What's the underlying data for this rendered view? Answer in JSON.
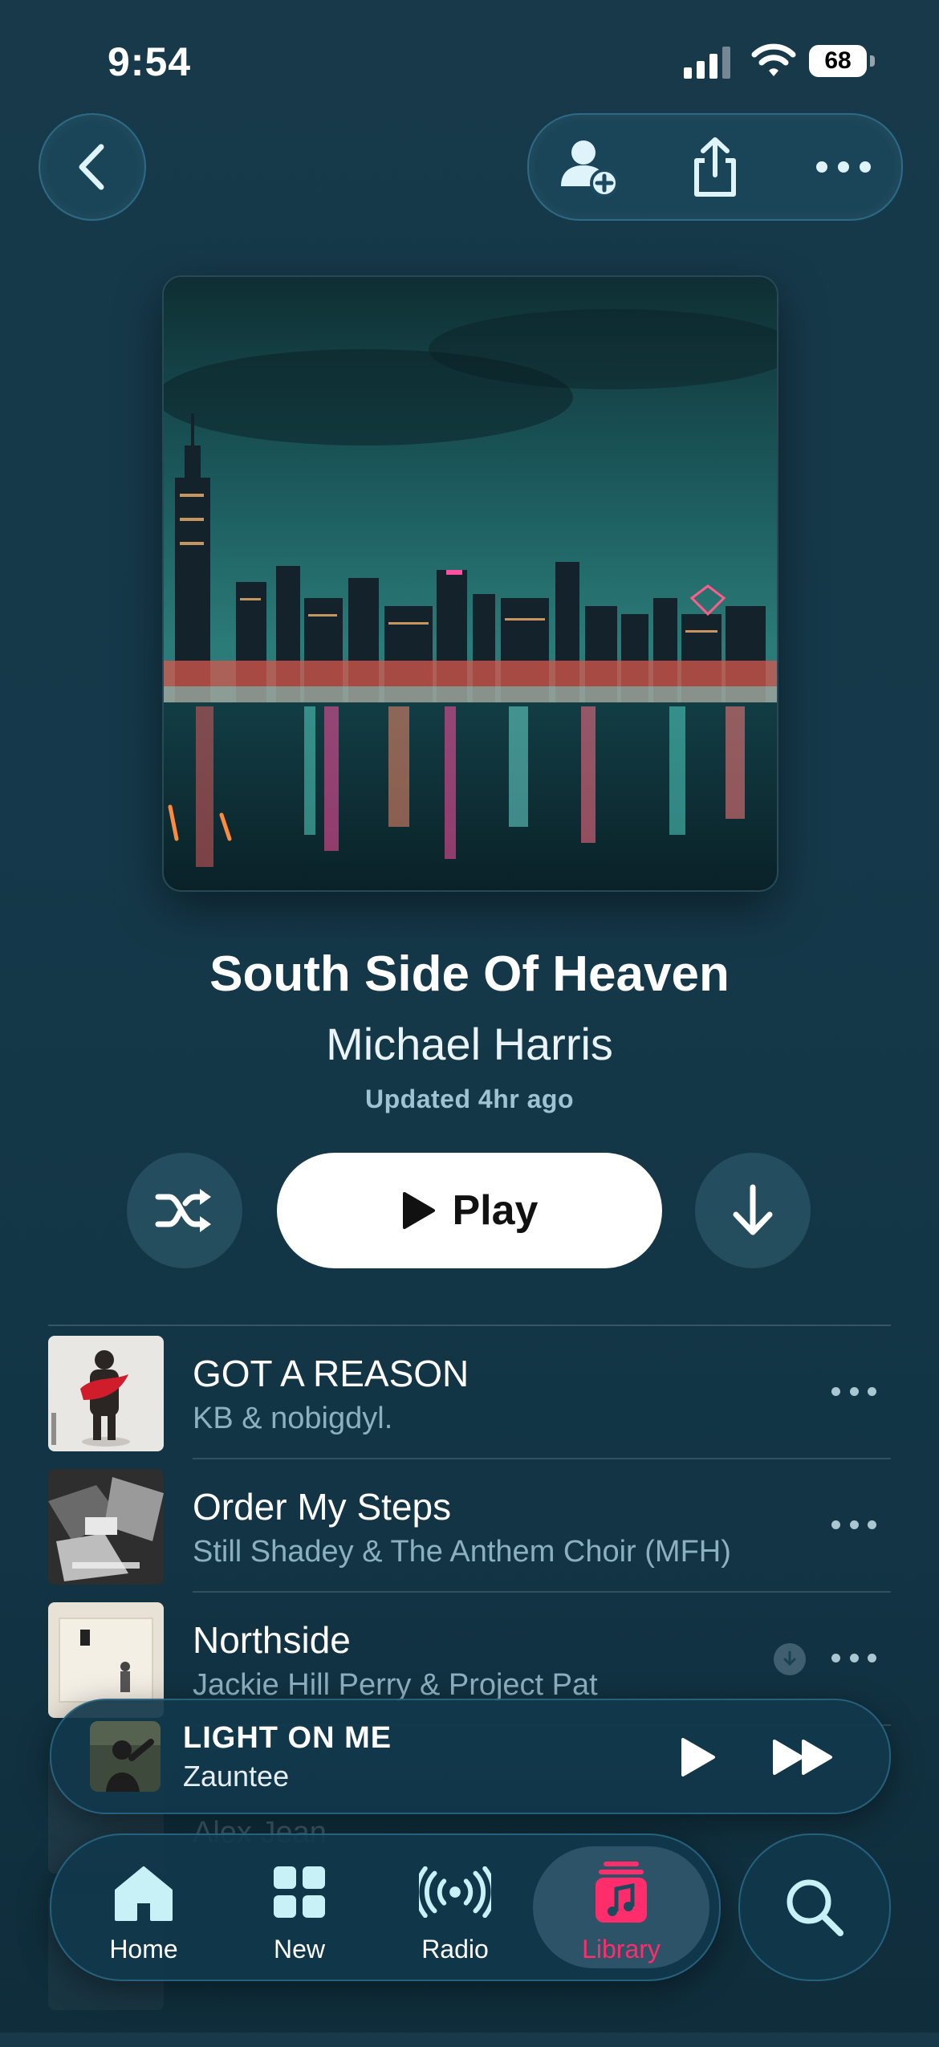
{
  "status_bar": {
    "time": "9:54",
    "battery": "68"
  },
  "header": {
    "back_icon": "chevron-left-icon",
    "actions": [
      "add-collaborator-icon",
      "share-icon",
      "more-icon"
    ]
  },
  "playlist": {
    "title": "South Side Of Heaven",
    "owner": "Michael Harris",
    "updated": "Updated 4hr ago"
  },
  "controls": {
    "shuffle_icon": "shuffle-icon",
    "play_label": "Play",
    "download_icon": "download-icon"
  },
  "tracks": [
    {
      "title": "GOT A REASON",
      "artist": "KB & nobigdyl.",
      "downloaded": false
    },
    {
      "title": "Order My Steps",
      "artist": "Still Shadey & The Anthem Choir (MFH)",
      "downloaded": false
    },
    {
      "title": "Northside",
      "artist": "Jackie Hill Perry & Project Pat",
      "downloaded": true
    },
    {
      "title": "",
      "artist": "Alex Jean",
      "downloaded": false
    }
  ],
  "now_playing": {
    "title": "LIGHT ON ME",
    "artist": "Zauntee"
  },
  "tab_bar": {
    "tabs": [
      {
        "label": "Home",
        "icon": "home-icon"
      },
      {
        "label": "New",
        "icon": "grid-icon"
      },
      {
        "label": "Radio",
        "icon": "radio-icon"
      },
      {
        "label": "Library",
        "icon": "music-note-icon",
        "selected": true
      }
    ],
    "search_icon": "search-icon"
  },
  "colors": {
    "accent": "#ff2d6b",
    "background": "#15394a",
    "secondary_text": "#8db0c0"
  }
}
